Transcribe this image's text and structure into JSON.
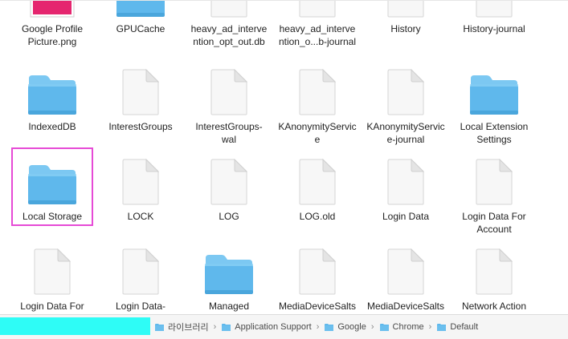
{
  "files": [
    {
      "label": "Google Profile\nPicture.png",
      "kind": "image",
      "color": "#e5266f"
    },
    {
      "label": "GPUCache",
      "kind": "folder"
    },
    {
      "label": "heavy_ad_interve\nntion_opt_out.db",
      "kind": "doc"
    },
    {
      "label": "heavy_ad_interve\nntion_o...b-journal",
      "kind": "doc"
    },
    {
      "label": "History",
      "kind": "doc"
    },
    {
      "label": "History-journal",
      "kind": "doc"
    },
    {
      "label": "IndexedDB",
      "kind": "folder"
    },
    {
      "label": "InterestGroups",
      "kind": "doc"
    },
    {
      "label": "InterestGroups-\nwal",
      "kind": "doc"
    },
    {
      "label": "KAnonymityServic\ne",
      "kind": "doc"
    },
    {
      "label": "KAnonymityServic\ne-journal",
      "kind": "doc"
    },
    {
      "label": "Local Extension\nSettings",
      "kind": "folder"
    },
    {
      "label": "Local Storage",
      "kind": "folder",
      "selected": true
    },
    {
      "label": "LOCK",
      "kind": "doc"
    },
    {
      "label": "LOG",
      "kind": "doc"
    },
    {
      "label": "LOG.old",
      "kind": "doc"
    },
    {
      "label": "Login Data",
      "kind": "doc"
    },
    {
      "label": "Login Data For\nAccount",
      "kind": "doc"
    },
    {
      "label": "Login Data For\nAccount-journal",
      "kind": "doc"
    },
    {
      "label": "Login Data-\njournal",
      "kind": "doc"
    },
    {
      "label": "Managed\nExtension Settings",
      "kind": "folder"
    },
    {
      "label": "MediaDeviceSalts",
      "kind": "doc"
    },
    {
      "label": "MediaDeviceSalts\n-journal",
      "kind": "doc"
    },
    {
      "label": "Network Action\nPredictor",
      "kind": "doc"
    }
  ],
  "pathbar": {
    "crumbs": [
      "라이브러리",
      "Application Support",
      "Google",
      "Chrome",
      "Default"
    ]
  },
  "colors": {
    "folder_top": "#7cc8f2",
    "folder_body": "#5fb8ec",
    "selection_outline": "#e64ad6",
    "redaction": "#2efcf6"
  }
}
